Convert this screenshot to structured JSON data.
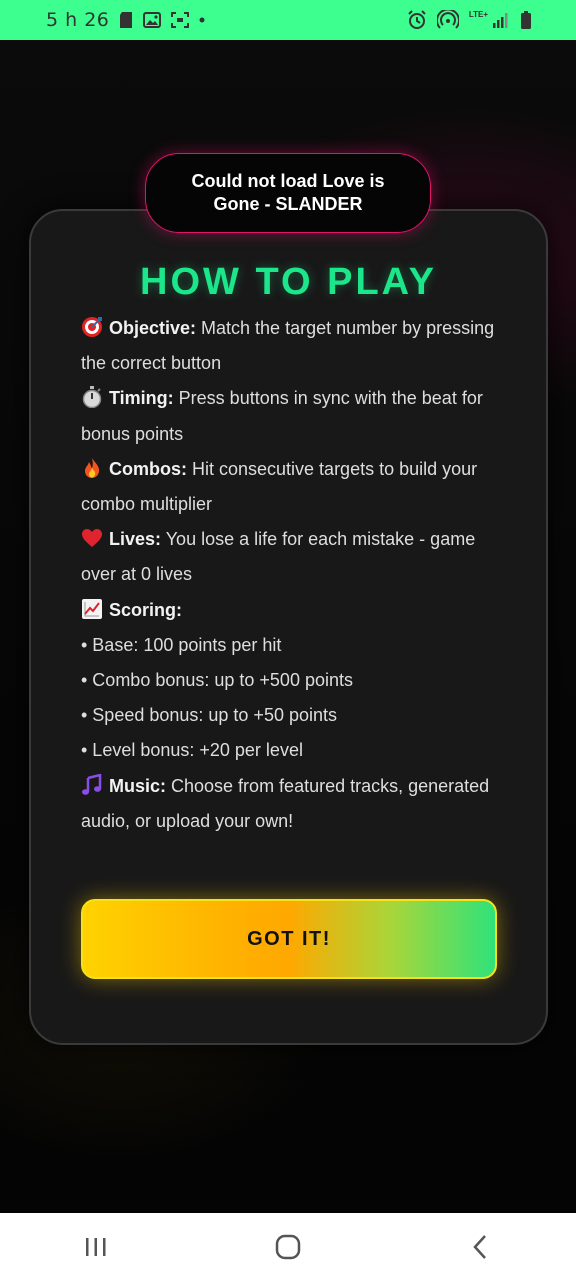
{
  "status_bar": {
    "time": "5 h 26",
    "network_label": "LTE+",
    "left_icons": [
      "sd-card-icon",
      "image-icon",
      "screenshot-icon",
      "dot-icon"
    ],
    "right_icons": [
      "alarm-icon",
      "hotspot-icon",
      "signal-icon",
      "battery-icon"
    ]
  },
  "toast": {
    "message": "Could not load Love is Gone - SLANDER",
    "border_color": "#e3126a"
  },
  "modal": {
    "title": "HOW TO PLAY",
    "title_color": "#1ce68a",
    "items": [
      {
        "icon": "target-icon",
        "label": "Objective:",
        "text": " Match the target number by pressing the correct button"
      },
      {
        "icon": "stopwatch-icon",
        "label": "Timing:",
        "text": " Press buttons in sync with the beat for bonus points"
      },
      {
        "icon": "fire-icon",
        "label": "Combos:",
        "text": " Hit consecutive targets to build your combo multiplier"
      },
      {
        "icon": "heart-icon",
        "label": "Lives:",
        "text": " You lose a life for each mistake - game over at 0 lives"
      },
      {
        "icon": "chart-icon",
        "label": "Scoring:",
        "text": ""
      }
    ],
    "scoring_bullets": [
      "• Base: 100 points per hit",
      "• Combo bonus: up to +500 points",
      "• Speed bonus: up to +50 points",
      "• Level bonus: +20 per level"
    ],
    "music": {
      "icon": "music-notes-icon",
      "label": "Music:",
      "text": " Choose from featured tracks, generated audio, or upload your own!"
    },
    "button_label": "GOT IT!"
  },
  "nav_bar": {
    "buttons": [
      "recent-apps-icon",
      "home-icon",
      "back-icon"
    ]
  }
}
